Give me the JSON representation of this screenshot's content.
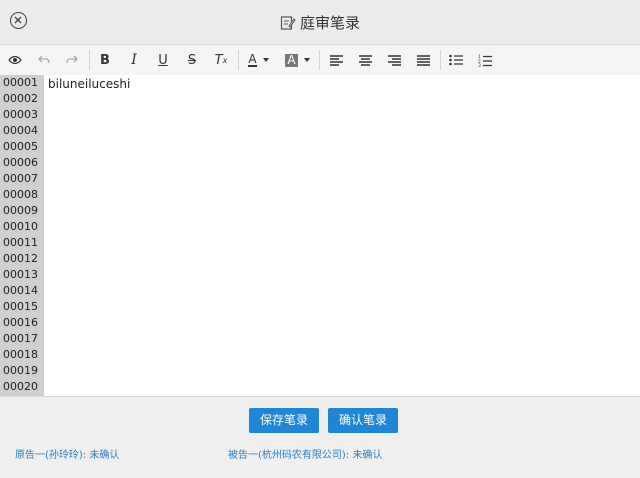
{
  "header": {
    "title": "庭审笔录"
  },
  "toolbar": {
    "items": [
      "preview-eye-icon",
      "undo-icon",
      "redo-icon",
      "bold-icon",
      "italic-icon",
      "underline-icon",
      "strikethrough-icon",
      "clear-format-icon",
      "font-color-icon",
      "background-color-icon",
      "align-left-icon",
      "align-center-icon",
      "align-right-icon",
      "align-justify-icon",
      "bullet-list-icon",
      "numbered-list-icon"
    ],
    "labels": {
      "bold": "B",
      "italic": "I",
      "underline": "U",
      "strike": "S",
      "clear": "T",
      "fontcolor": "A",
      "bgcolor": "A"
    }
  },
  "editor": {
    "line_numbers": [
      "00001",
      "00002",
      "00003",
      "00004",
      "00005",
      "00006",
      "00007",
      "00008",
      "00009",
      "00010",
      "00011",
      "00012",
      "00013",
      "00014",
      "00015",
      "00016",
      "00017",
      "00018",
      "00019",
      "00020"
    ],
    "content": "biluneiluceshi"
  },
  "footer": {
    "save_label": "保存笔录",
    "confirm_label": "确认笔录",
    "plaintiff_status": "原告一(孙玲玲): 未确认",
    "defendant_status": "被告一(杭州码农有限公司): 未确认"
  },
  "colors": {
    "accent": "#1e86d4",
    "link": "#2e7cc0"
  }
}
